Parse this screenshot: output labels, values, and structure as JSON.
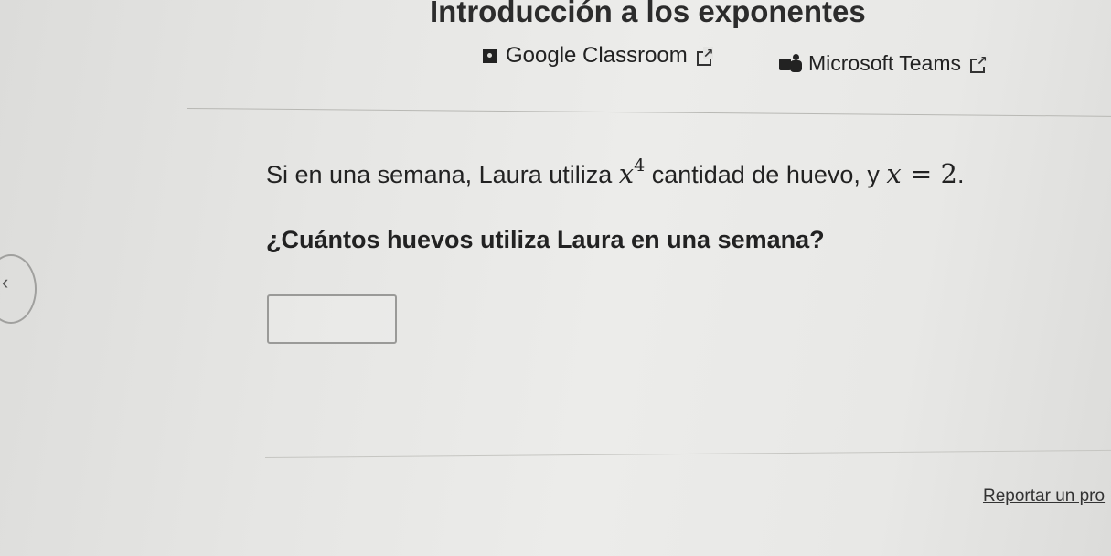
{
  "header": {
    "title": "Introducción a los exponentes"
  },
  "share": {
    "google_classroom": {
      "label": "Google Classroom",
      "icon": "google-classroom-icon"
    },
    "microsoft_teams": {
      "label": "Microsoft Teams",
      "icon": "microsoft-teams-icon"
    }
  },
  "question": {
    "text_before": "Si en una semana, Laura utiliza ",
    "variable": "x",
    "exponent": "4",
    "text_middle": " cantidad de huevo, y ",
    "equation_var": "x",
    "equation_rest": " = 2",
    "text_end": ".",
    "prompt": "¿Cuántos huevos utiliza Laura en una semana?"
  },
  "answer": {
    "value": "",
    "placeholder": ""
  },
  "footer": {
    "report_label": "Reportar un pro"
  }
}
